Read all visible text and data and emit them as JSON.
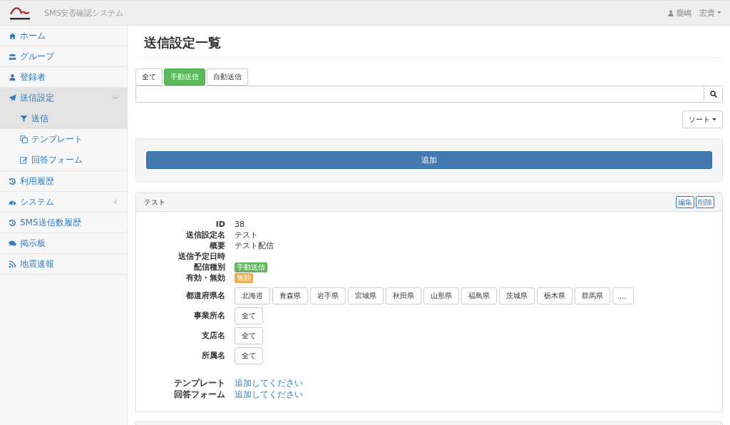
{
  "navbar": {
    "app_name": "SMS安否確認システム",
    "user": "鹿嶋　宏貴"
  },
  "sidebar": {
    "items": [
      {
        "label": "ホーム",
        "selected": false
      },
      {
        "label": "グループ",
        "selected": false
      },
      {
        "label": "登録者",
        "selected": false
      },
      {
        "label": "送信設定",
        "selected": true,
        "expanded": true,
        "children": [
          {
            "label": "送信",
            "selected": true
          },
          {
            "label": "テンプレート",
            "selected": false
          },
          {
            "label": "回答フォーム",
            "selected": false
          }
        ]
      },
      {
        "label": "利用履歴",
        "selected": false
      },
      {
        "label": "システム",
        "selected": false,
        "expanded": false
      },
      {
        "label": "SMS送信数履歴",
        "selected": false
      },
      {
        "label": "掲示板",
        "selected": false
      },
      {
        "label": "地震速報",
        "selected": false
      }
    ]
  },
  "page_title": "送信設定一覧",
  "filter_tabs": [
    {
      "label": "全て",
      "selected": false
    },
    {
      "label": "手動送信",
      "selected": true
    },
    {
      "label": "自動送信",
      "selected": false
    }
  ],
  "sort_button": "ソート",
  "add_button": "追加",
  "cards": [
    {
      "title": "テスト",
      "edit_button": "編集",
      "delete_button": "削除",
      "fields": [
        {
          "kind": "text",
          "label": "ID",
          "value": "38"
        },
        {
          "kind": "text",
          "label": "送信設定名",
          "value": "テスト"
        },
        {
          "kind": "text",
          "label": "概要",
          "value": "テスト配信"
        },
        {
          "kind": "text",
          "label": "送信予定日時"
        },
        {
          "kind": "badge",
          "label": "配信種別",
          "value": "手動送信",
          "color": "#5cb85c"
        },
        {
          "kind": "badge",
          "label": "有効・無効",
          "value": "無効",
          "color": "#f0ad4e"
        },
        {
          "kind": "buttons",
          "label": "都道府県名",
          "values": [
            "北海道",
            "青森県",
            "岩手県",
            "宮城県",
            "秋田県",
            "山形県",
            "福島県",
            "茨城県",
            "栃木県",
            "群馬県",
            "..."
          ]
        },
        {
          "kind": "buttons",
          "label": "事業所名",
          "values": [
            "全て"
          ]
        },
        {
          "kind": "buttons",
          "label": "支店名",
          "values": [
            "全て"
          ]
        },
        {
          "kind": "buttons",
          "label": "所属名",
          "values": [
            "全て"
          ]
        },
        {
          "kind": "link",
          "label": "テンプレート",
          "value": "追加してください"
        },
        {
          "kind": "link",
          "label": "回答フォーム",
          "value": "追加してください"
        }
      ]
    },
    {
      "kind": "cut_off"
    }
  ]
}
